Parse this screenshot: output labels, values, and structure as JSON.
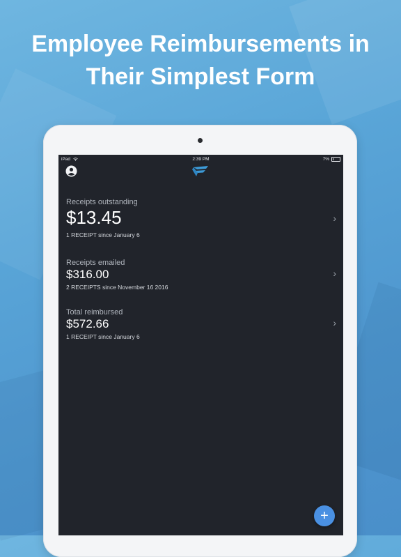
{
  "headline": {
    "line1": "Employee Reimbursements in",
    "line2": "Their Simplest Form"
  },
  "status_bar": {
    "device": "iPad",
    "time": "2:39 PM",
    "battery": "7%"
  },
  "icons": {
    "profile": "user-circle-icon",
    "logo": "app-logo-icon",
    "add": "plus-icon",
    "chevron": "chevron-right-icon"
  },
  "cards": [
    {
      "label": "Receipts outstanding",
      "amount": "$13.45",
      "subtitle": "1 RECEIPT since January 6",
      "chevron": "›"
    },
    {
      "label": "Receipts emailed",
      "amount": "$316.00",
      "subtitle": "2 RECEIPTS since November 16 2016",
      "chevron": "›"
    },
    {
      "label": "Total reimbursed",
      "amount": "$572.66",
      "subtitle": "1 RECEIPT since January 6",
      "chevron": "›"
    }
  ],
  "fab": {
    "label": "+"
  },
  "colors": {
    "background": "#5aa6d8",
    "screen": "#21242b",
    "accent": "#4a90e2",
    "logo": "#3d9bd8"
  }
}
